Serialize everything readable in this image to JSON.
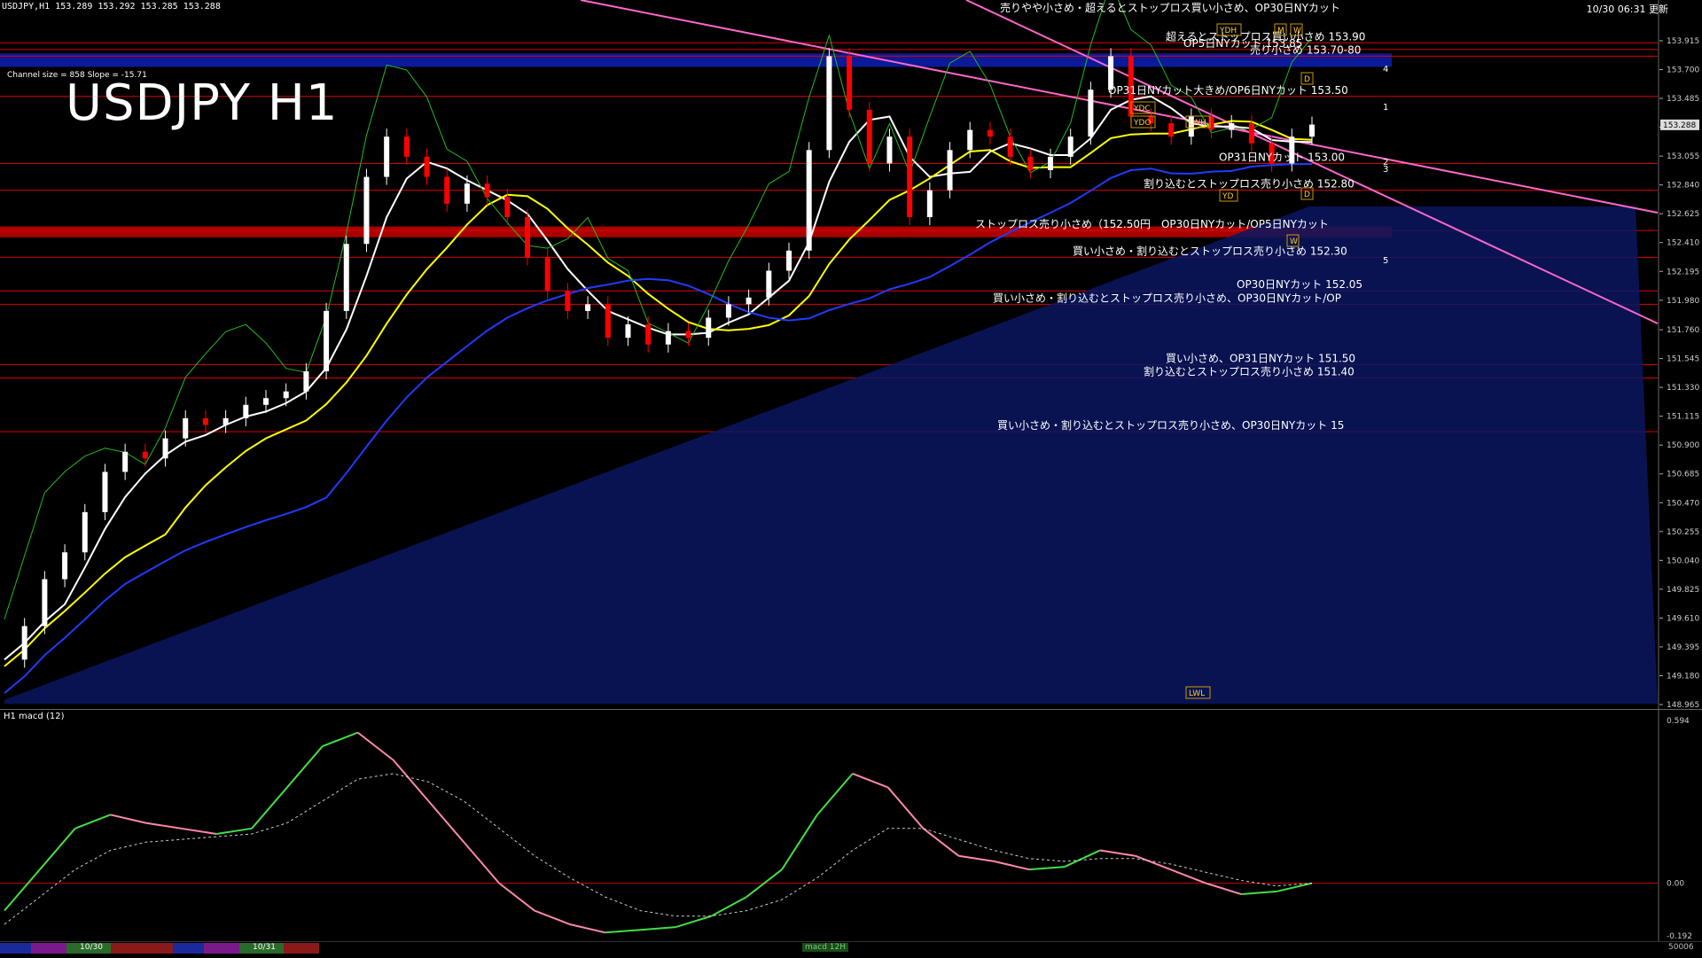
{
  "header": {
    "symbol_line": "USDJPY,H1  153.289 153.292 153.285 153.288",
    "timestamp": "10/30 06:31 更新",
    "big_title": "USDJPY H1",
    "channel_info": "Channel size = 858 Slope = -15.71"
  },
  "colors": {
    "background": "#000000",
    "bull_candle": "#ffffff",
    "bear_candle": "#ff0000",
    "ma_white": "#ffffff",
    "ma_yellow": "#ffff00",
    "ma_blue": "#1e3cff",
    "channel": "#ff66cc",
    "chikou": "#22bb22",
    "support": "#dd0000",
    "resistance_band": "#0a1a99",
    "macd_up": "#44dd44",
    "macd_down": "#ff88aa"
  },
  "chart_data": [
    {
      "type": "line",
      "title": "USDJPY H1",
      "ylim": [
        148.965,
        154.1
      ],
      "yticks": [
        "153.915",
        "153.700",
        "153.485",
        "153.270",
        "153.055",
        "152.840",
        "152.625",
        "152.410",
        "152.195",
        "151.980",
        "151.760",
        "151.545",
        "151.330",
        "151.115",
        "150.900",
        "150.685",
        "150.470",
        "150.255",
        "150.040",
        "149.825",
        "149.610",
        "149.395",
        "149.180",
        "148.965"
      ],
      "current_price": "153.288",
      "price_path": [
        149.3,
        149.55,
        149.9,
        150.1,
        150.4,
        150.7,
        150.85,
        150.8,
        150.95,
        151.1,
        151.05,
        151.1,
        151.2,
        151.25,
        151.3,
        151.45,
        151.9,
        152.4,
        152.9,
        153.2,
        153.05,
        152.9,
        152.7,
        152.85,
        152.75,
        152.6,
        152.3,
        152.05,
        151.9,
        151.95,
        151.7,
        151.8,
        151.65,
        151.75,
        151.7,
        151.85,
        151.95,
        152.0,
        152.2,
        152.35,
        153.1,
        153.8,
        153.4,
        153.0,
        153.2,
        152.6,
        152.8,
        153.1,
        153.25,
        153.2,
        153.05,
        152.95,
        153.05,
        153.2,
        153.55,
        153.8,
        153.35,
        153.3,
        153.2,
        153.35,
        153.25,
        153.3,
        153.15,
        153.0,
        153.2,
        153.29
      ],
      "levels": [
        {
          "price": "153.90",
          "label": "超えるとストップロス買い小さめ 153.90"
        },
        {
          "price": "153.85",
          "label": "OP5日NYカット 153.85"
        },
        {
          "price": "153.80",
          "label": "売り小さめ 153.70-80"
        },
        {
          "price": "153.50",
          "label": "OP31日NYカット大きめ/OP6日NYカット 153.50"
        },
        {
          "price": "153.00",
          "label": "OP31日NYカット 153.00"
        },
        {
          "price": "152.80",
          "label": "割り込むとストップロス売り小さめ 152.80"
        },
        {
          "price": "152.50",
          "label": "ストップロス売り小さめ（152.50円　OP30日NYカット/OP5日NYカット"
        },
        {
          "price": "152.30",
          "label": "買い小さめ・割り込むとストップロス売り小さめ 152.30"
        },
        {
          "price": "152.05",
          "label": "OP30日NYカット 152.05"
        },
        {
          "price": "151.95",
          "label": "買い小さめ・割り込むとストップロス売り小さめ、OP30日NYカット/OP"
        },
        {
          "price": "151.50",
          "label": "買い小さめ、OP31日NYカット 151.50"
        },
        {
          "price": "151.40",
          "label": "割り込むとストップロス売り小さめ 151.40"
        },
        {
          "price": "151.00",
          "label": "買い小さめ・割り込むとストップロス売り小さめ、OP30日NYカット 15"
        }
      ],
      "top_note": "売りやや小さめ・超えるとストップロス買い小さめ、OP30日NYカット",
      "markers": [
        "YDH",
        "M",
        "W",
        "D",
        "YDC",
        "YDO",
        "LWH",
        "YD",
        "D",
        "W",
        "LWL"
      ],
      "channel_numbers": [
        "1",
        "2",
        "3",
        "4",
        "5"
      ]
    },
    {
      "type": "line",
      "title": "H1  macd (12)",
      "ylim": [
        -0.192,
        0.594
      ],
      "yticks": [
        "0.594",
        "0.00",
        "-0.192"
      ],
      "macd": [
        -0.1,
        0.05,
        0.2,
        0.25,
        0.22,
        0.2,
        0.18,
        0.2,
        0.35,
        0.5,
        0.55,
        0.45,
        0.3,
        0.15,
        0.0,
        -0.1,
        -0.15,
        -0.18,
        -0.17,
        -0.16,
        -0.12,
        -0.05,
        0.05,
        0.25,
        0.4,
        0.35,
        0.2,
        0.1,
        0.08,
        0.05,
        0.06,
        0.12,
        0.1,
        0.05,
        0.0,
        -0.04,
        -0.03,
        0.0
      ],
      "signal": [
        -0.15,
        -0.05,
        0.05,
        0.12,
        0.15,
        0.16,
        0.17,
        0.18,
        0.22,
        0.3,
        0.38,
        0.4,
        0.37,
        0.3,
        0.2,
        0.1,
        0.02,
        -0.05,
        -0.1,
        -0.12,
        -0.12,
        -0.1,
        -0.06,
        0.02,
        0.12,
        0.2,
        0.2,
        0.16,
        0.12,
        0.09,
        0.08,
        0.09,
        0.09,
        0.07,
        0.04,
        0.01,
        -0.01,
        0.0
      ]
    }
  ],
  "bottom": {
    "date1": "10/30",
    "date2": "10/31",
    "tab_label": "macd 12H",
    "corner": "50006"
  }
}
